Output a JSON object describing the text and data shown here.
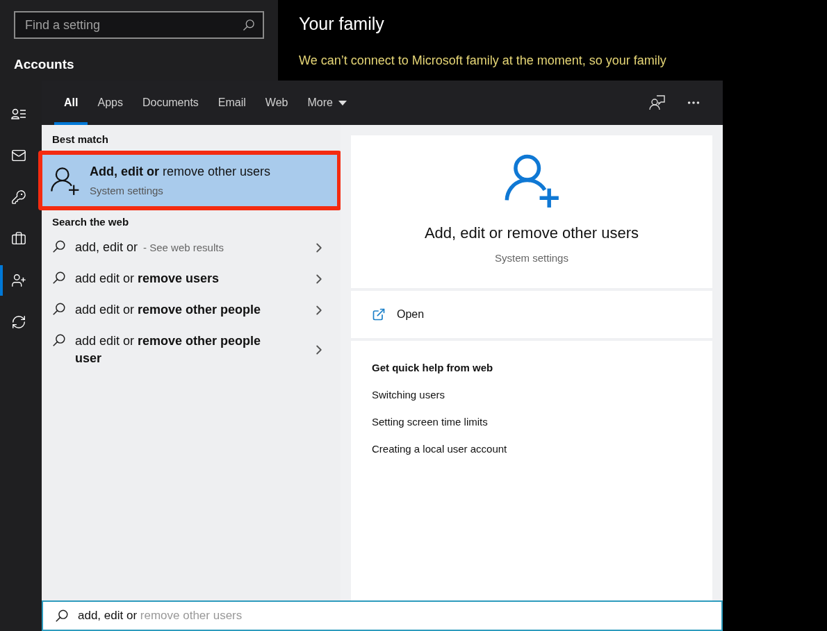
{
  "settings": {
    "search": {
      "placeholder": "Find a setting"
    },
    "section": "Accounts",
    "sidebar": {
      "items": [
        {
          "selected": false
        },
        {
          "selected": false
        },
        {
          "selected": false
        },
        {
          "selected": false
        },
        {
          "selected": true
        },
        {
          "selected": false
        }
      ]
    },
    "page_title": "Your family",
    "warning": "We can’t connect to Microsoft family at the moment, so your family"
  },
  "search_panel": {
    "tabs": [
      {
        "label": "All",
        "selected": true,
        "kind": "plain"
      },
      {
        "label": "Apps",
        "selected": false,
        "kind": "plain"
      },
      {
        "label": "Documents",
        "selected": false,
        "kind": "plain"
      },
      {
        "label": "Email",
        "selected": false,
        "kind": "plain"
      },
      {
        "label": "Web",
        "selected": false,
        "kind": "plain"
      },
      {
        "label": "More",
        "selected": false,
        "kind": "dropdown"
      }
    ],
    "best_match_heading": "Best match",
    "best_match": {
      "title": "**Add, edit or** remove other users",
      "subtitle": "System settings",
      "selected": true
    },
    "web_heading": "Search the web",
    "web_results": [
      {
        "text": "add, edit or",
        "hint": "- See web results"
      },
      {
        "text": "add edit or **remove users**"
      },
      {
        "text": "add edit or **remove other people**"
      },
      {
        "text": "add edit or **remove other people user**"
      }
    ],
    "preview": {
      "title": "Add, edit or remove other users",
      "subtitle": "System settings",
      "action": "Open",
      "help_heading": "Get quick help from web",
      "help_links": [
        "Switching users",
        "Setting screen time limits",
        "Creating a local user account"
      ]
    },
    "query": {
      "value": "add, edit or",
      "completion": "remove other users"
    }
  }
}
